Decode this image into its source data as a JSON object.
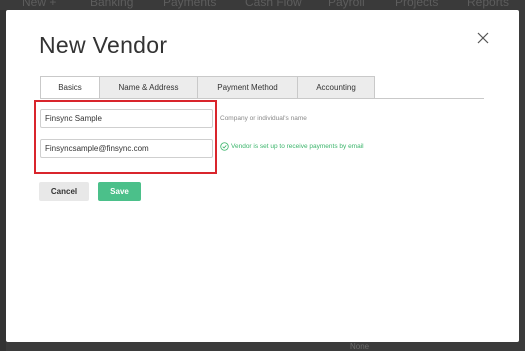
{
  "background": {
    "nav_items": [
      "New +",
      "Banking",
      "Payments",
      "Cash Flow",
      "Payroll",
      "Projects",
      "Reports"
    ],
    "bottom_text": "None"
  },
  "modal": {
    "title": "New Vendor",
    "close_icon": "close-icon"
  },
  "tabs": [
    {
      "label": "Basics",
      "active": true
    },
    {
      "label": "Name & Address",
      "active": false
    },
    {
      "label": "Payment Method",
      "active": false
    },
    {
      "label": "Accounting",
      "active": false
    }
  ],
  "form": {
    "name_value": "Finsync Sample",
    "name_hint": "Company or individual's name",
    "email_value": "Finsyncsample@finsync.com",
    "email_status": "Vendor is set up to receive payments by email",
    "status_icon": "check-circle-icon"
  },
  "buttons": {
    "cancel_label": "Cancel",
    "save_label": "Save"
  },
  "colors": {
    "accent_green": "#4bc08a",
    "status_green": "#3bb56b",
    "highlight_red": "#d9252c"
  }
}
